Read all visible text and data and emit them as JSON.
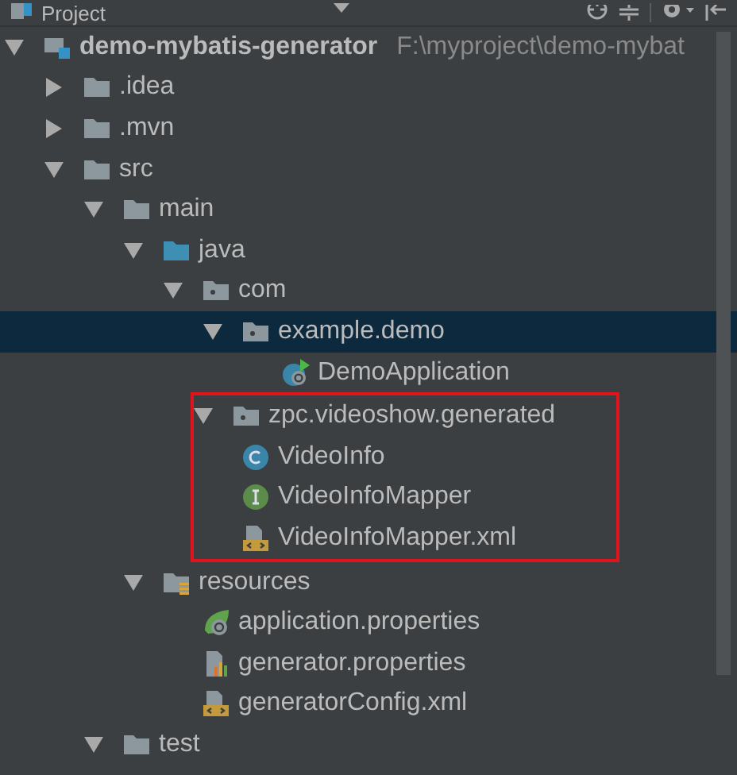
{
  "panel": {
    "title": "Project"
  },
  "tree": [
    {
      "label": "demo-mybatis-generator",
      "path": "F:\\myproject\\demo-mybat",
      "kind": "module",
      "expanded": true,
      "selected": false,
      "children": [
        {
          "label": ".idea",
          "kind": "folder",
          "expanded": false,
          "selected": false
        },
        {
          "label": ".mvn",
          "kind": "folder",
          "expanded": false,
          "selected": false
        },
        {
          "label": "src",
          "kind": "folder",
          "expanded": true,
          "selected": false,
          "children": [
            {
              "label": "main",
              "kind": "folder",
              "expanded": true,
              "selected": false,
              "children": [
                {
                  "label": "java",
                  "kind": "source-root",
                  "expanded": true,
                  "selected": false,
                  "children": [
                    {
                      "label": "com",
                      "kind": "package",
                      "expanded": true,
                      "selected": false,
                      "children": [
                        {
                          "label": "example.demo",
                          "kind": "package",
                          "expanded": true,
                          "selected": true,
                          "children": [
                            {
                              "label": "DemoApplication",
                              "kind": "boot-app",
                              "selected": false
                            }
                          ]
                        }
                      ]
                    },
                    {
                      "label": "zpc.videoshow.generated",
                      "kind": "package",
                      "expanded": true,
                      "selected": false,
                      "highlighted": true,
                      "children": [
                        {
                          "label": "VideoInfo",
                          "kind": "class",
                          "selected": false
                        },
                        {
                          "label": "VideoInfoMapper",
                          "kind": "interface",
                          "selected": false
                        },
                        {
                          "label": "VideoInfoMapper.xml",
                          "kind": "xml",
                          "selected": false
                        }
                      ]
                    }
                  ]
                },
                {
                  "label": "resources",
                  "kind": "resources-root",
                  "expanded": true,
                  "selected": false,
                  "children": [
                    {
                      "label": "application.properties",
                      "kind": "spring-properties",
                      "selected": false
                    },
                    {
                      "label": "generator.properties",
                      "kind": "properties",
                      "selected": false
                    },
                    {
                      "label": "generatorConfig.xml",
                      "kind": "xml",
                      "selected": false
                    }
                  ]
                }
              ]
            },
            {
              "label": "test",
              "kind": "folder",
              "expanded": true,
              "selected": false
            }
          ]
        }
      ]
    }
  ]
}
